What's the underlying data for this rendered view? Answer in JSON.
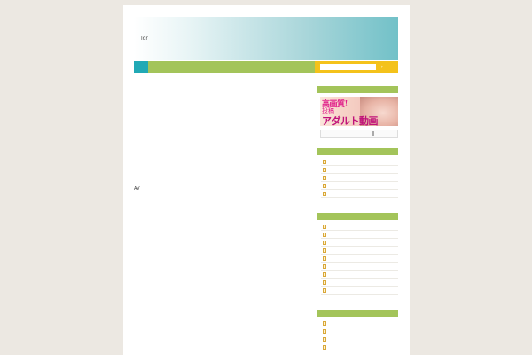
{
  "header": {
    "site_title": "lor"
  },
  "nav": {
    "search_placeholder": "",
    "search_button": "›"
  },
  "content": {
    "main_text": "AV"
  },
  "sidebar": {
    "banner": {
      "line1": "高画質!",
      "line2": "投稿",
      "line3": "アダルト動画"
    },
    "widget2_items": [
      "",
      "",
      "",
      "",
      ""
    ],
    "widget3_items": [
      "",
      "",
      "",
      "",
      "",
      "",
      "",
      "",
      ""
    ],
    "widget4_items": [
      "",
      "",
      "",
      ""
    ]
  },
  "colors": {
    "background": "#ece8e2",
    "accent_green": "#a3c45a",
    "accent_teal": "#21a9b5",
    "accent_yellow": "#f4c21b"
  }
}
